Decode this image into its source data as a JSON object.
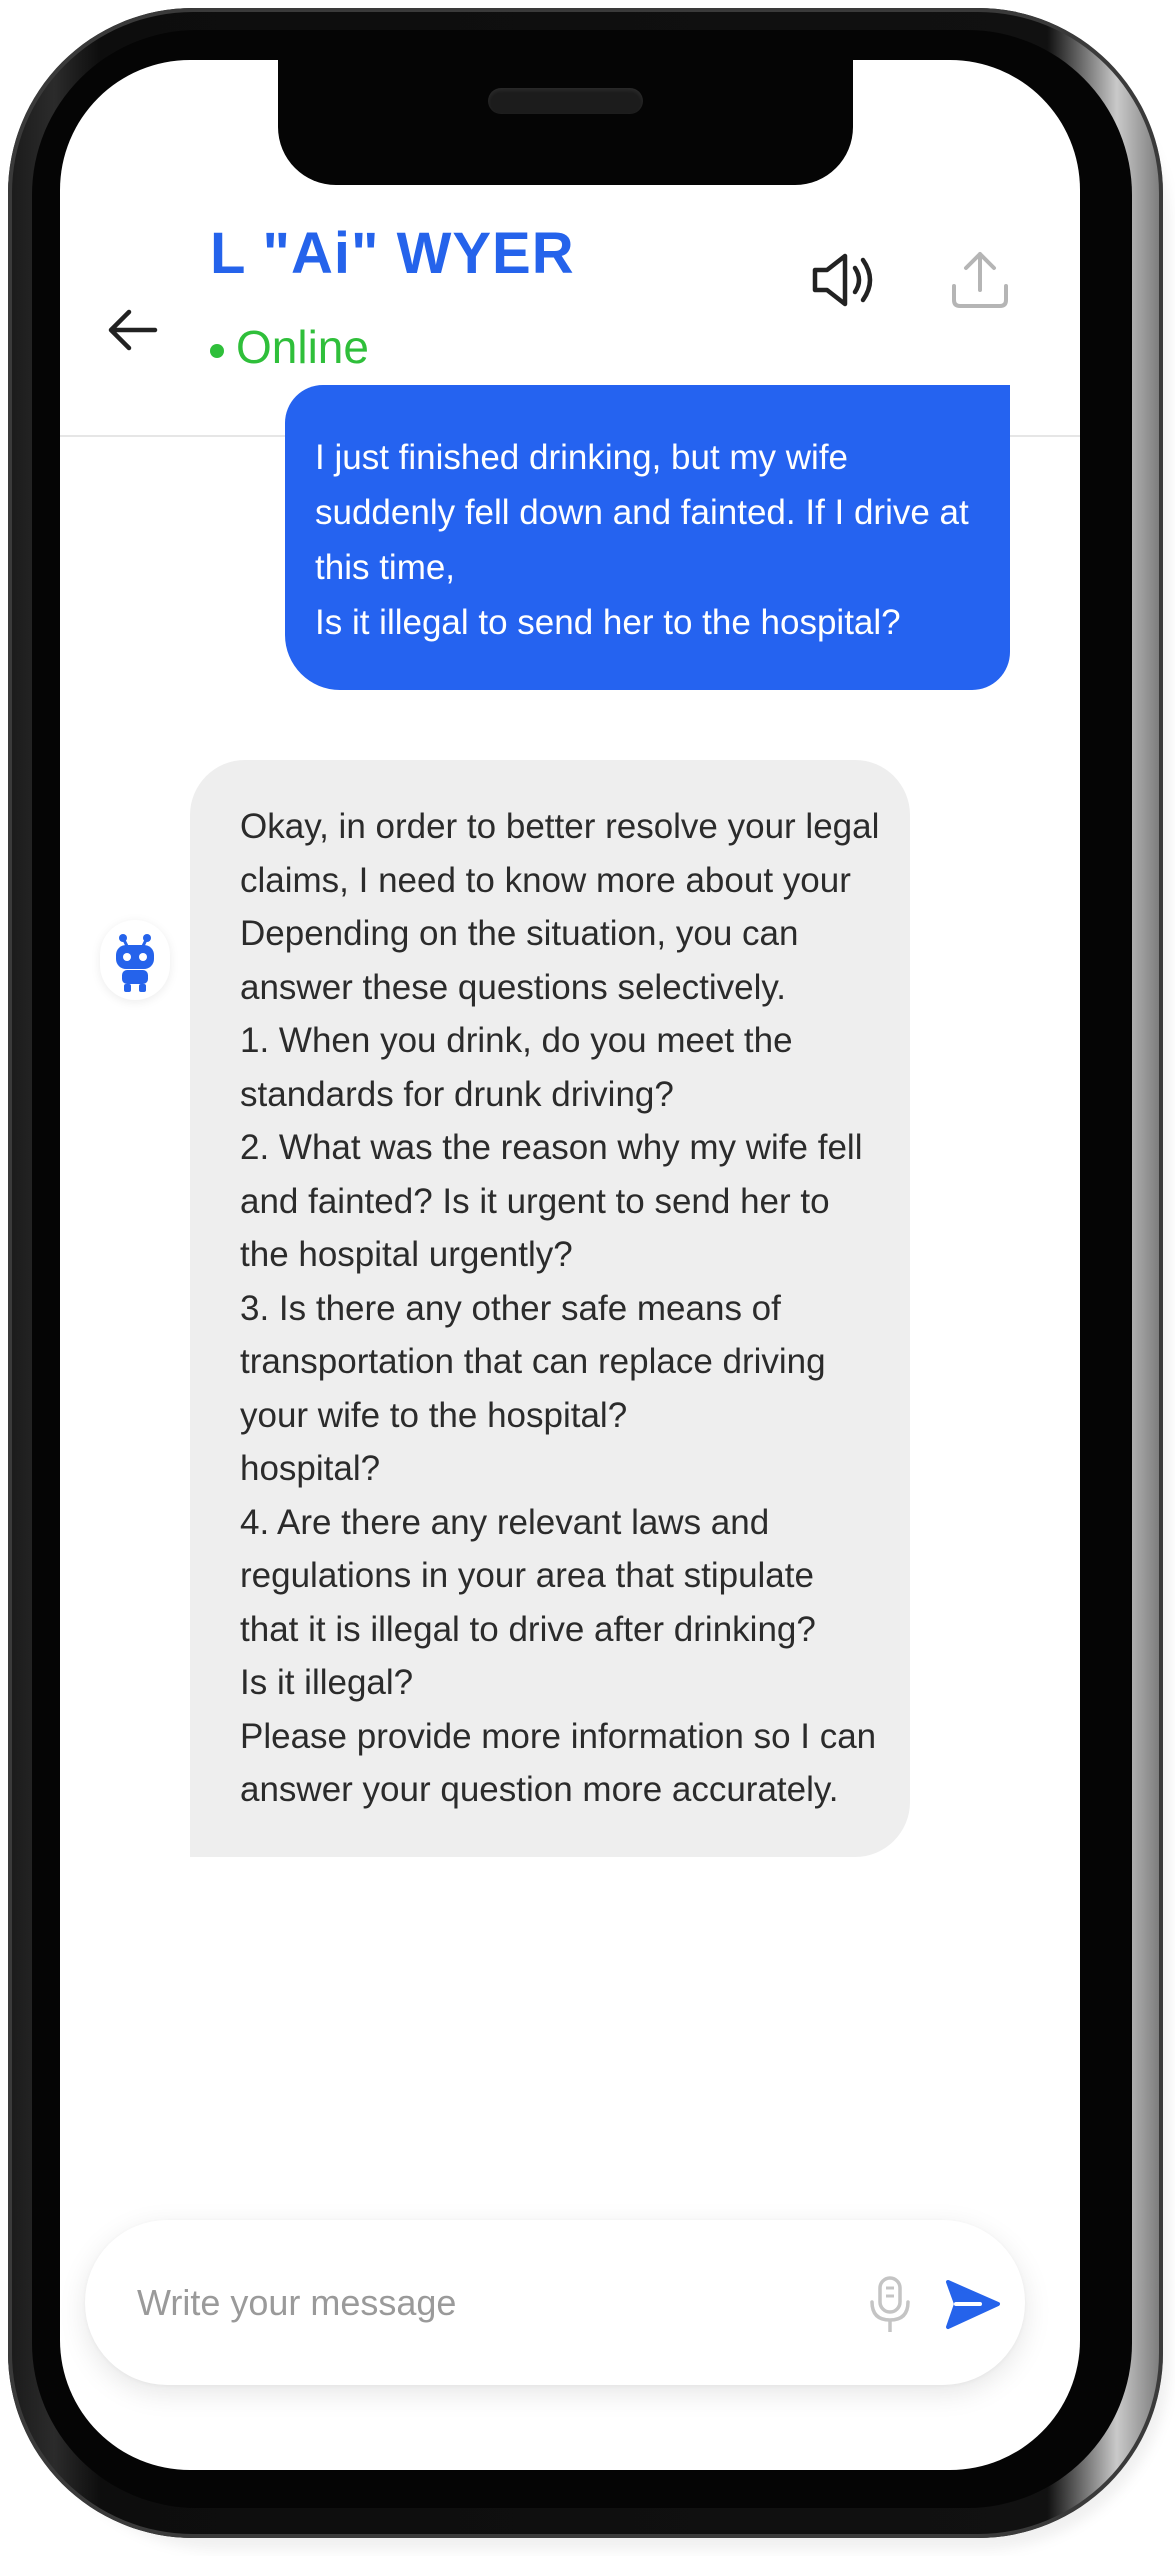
{
  "header": {
    "title": "L \"Ai\" WYER",
    "status": "Online"
  },
  "conversation": {
    "user_message": "I just finished drinking, but my wife suddenly fell down and fainted. If I drive at this time,\nIs it illegal to send her to the hospital?",
    "bot_message": "Okay, in order to better resolve your legal claims, I need to know more about your\nDepending on the situation, you can answer these questions selectively.\n1. When you drink, do you meet the standards for drunk driving?\n2. What was the reason why my wife fell and fainted? Is it urgent to send her to the hospital urgently?\n3. Is there any other safe means of transportation that can replace driving your wife to the hospital?\nhospital?\n4. Are there any relevant laws and regulations in your area that stipulate that it is illegal to drive after drinking?\nIs it illegal?\nPlease provide more information so I can answer your question more accurately."
  },
  "composer": {
    "placeholder": "Write your message"
  },
  "icons": {
    "back": "arrow-left-icon",
    "speaker": "speaker-icon",
    "share": "upload-icon",
    "avatar": "robot-icon",
    "mic": "microphone-icon",
    "send": "send-icon"
  },
  "colors": {
    "accent": "#2563eb",
    "online": "#2fbf3a",
    "user_bubble": "#2563f0",
    "bot_bubble": "#eeeeee"
  }
}
